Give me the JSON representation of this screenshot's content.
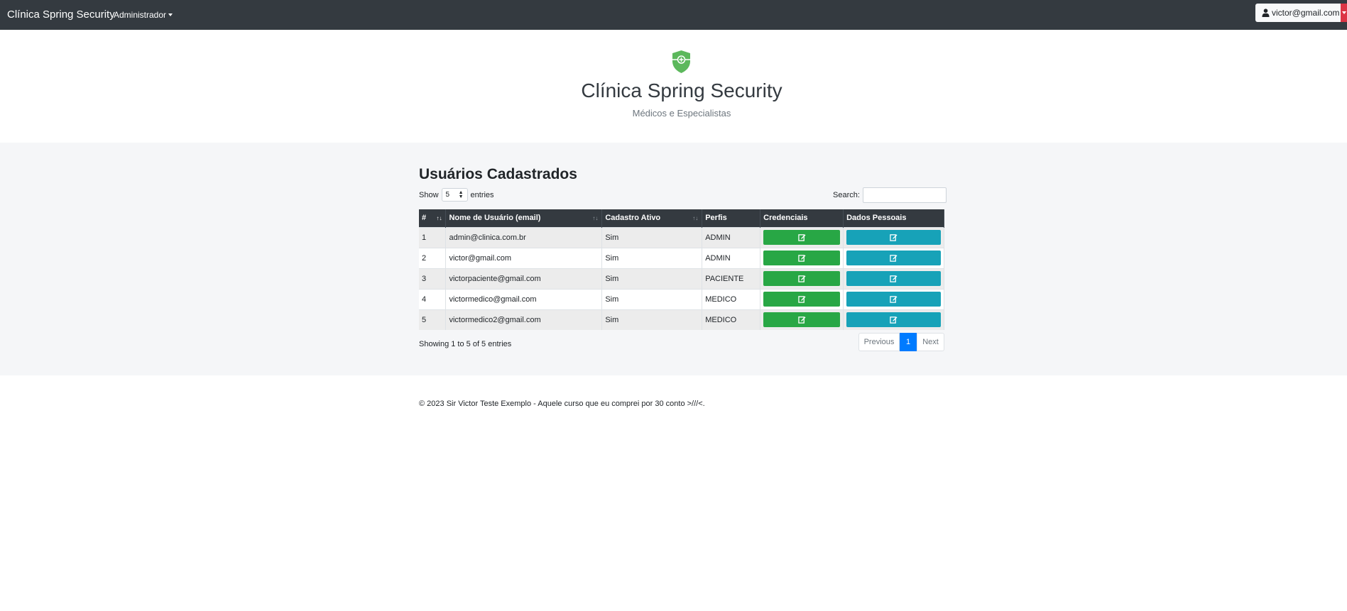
{
  "navbar": {
    "brand": "Clínica Spring Security",
    "admin_menu": "Administrador",
    "user": "victor@gmail.com"
  },
  "header": {
    "title": "Clínica Spring Security",
    "subtitle": "Médicos e Especialistas",
    "logo_icon": "shield-icon"
  },
  "main": {
    "heading": "Usuários Cadastrados",
    "show_label": "Show",
    "length_value": "5",
    "entries_label": "entries",
    "search_label": "Search:",
    "search_value": "",
    "columns": [
      "#",
      "Nome de Usuário (email)",
      "Cadastro Ativo",
      "Perfis",
      "Credenciais",
      "Dados Pessoais"
    ],
    "rows": [
      {
        "id": "1",
        "email": "admin@clinica.com.br",
        "ativo": "Sim",
        "perfis": "ADMIN"
      },
      {
        "id": "2",
        "email": "victor@gmail.com",
        "ativo": "Sim",
        "perfis": "ADMIN"
      },
      {
        "id": "3",
        "email": "victorpaciente@gmail.com",
        "ativo": "Sim",
        "perfis": "PACIENTE"
      },
      {
        "id": "4",
        "email": "victormedico@gmail.com",
        "ativo": "Sim",
        "perfis": "MEDICO"
      },
      {
        "id": "5",
        "email": "victormedico2@gmail.com",
        "ativo": "Sim",
        "perfis": "MEDICO"
      }
    ],
    "info": "Showing 1 to 5 of 5 entries",
    "pagination": {
      "previous": "Previous",
      "current": "1",
      "next": "Next"
    }
  },
  "footer": {
    "text": "© 2023 Sir Victor Teste Exemplo - Aquele curso que eu comprei por 30 conto >///<."
  },
  "colors": {
    "navbar": "#343a40",
    "credenciais_button": "#28a745",
    "dados_button": "#17a2b8",
    "logo": "#5cb85c",
    "user_toggle": "#dc3545",
    "page_active": "#007bff"
  }
}
